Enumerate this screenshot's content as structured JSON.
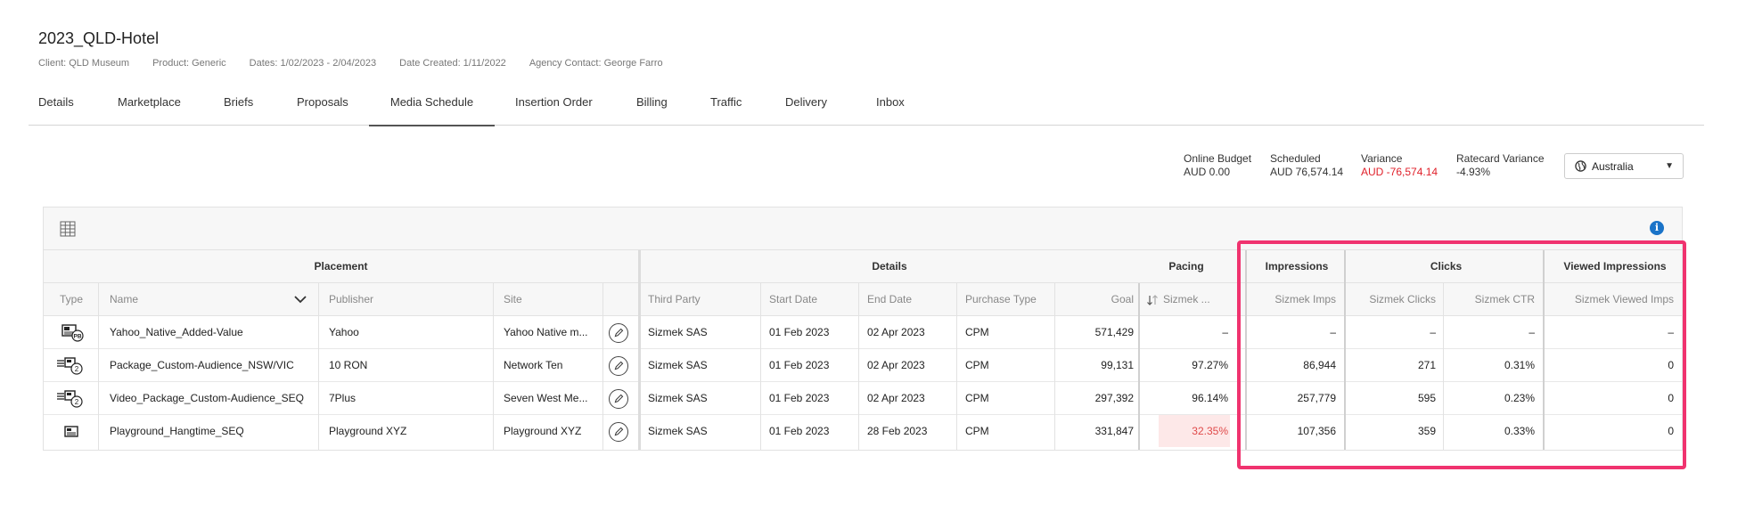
{
  "campaign": {
    "title": "2023_QLD-Hotel",
    "meta": [
      "Client: QLD Museum",
      "Product: Generic",
      "Dates: 1/02/2023 - 2/04/2023",
      "Date Created: 1/11/2022",
      "Agency Contact: George Farro"
    ]
  },
  "tabs": [
    {
      "label": "Details"
    },
    {
      "label": "Marketplace"
    },
    {
      "label": "Briefs"
    },
    {
      "label": "Proposals"
    },
    {
      "label": "Media Schedule",
      "active": true
    },
    {
      "label": "Insertion Order"
    },
    {
      "label": "Billing"
    },
    {
      "label": "Traffic"
    },
    {
      "label": "Delivery"
    },
    {
      "label": "Inbox"
    }
  ],
  "summary": {
    "online_budget": {
      "label": "Online Budget",
      "value": "AUD 0.00"
    },
    "scheduled": {
      "label": "Scheduled",
      "value": "AUD 76,574.14"
    },
    "variance": {
      "label": "Variance",
      "value": "AUD -76,574.14"
    },
    "ratecard_variance": {
      "label": "Ratecard Variance",
      "value": "-4.93%"
    }
  },
  "region": {
    "selected": "Australia",
    "icon": "globe-icon"
  },
  "table": {
    "groups": [
      "Placement",
      "Details",
      "Pacing",
      "Impressions",
      "Clicks",
      "Viewed Impressions"
    ],
    "columns": [
      "Type",
      "Name",
      "Publisher",
      "Site",
      "Third Party",
      "Start Date",
      "End Date",
      "Purchase Type",
      "Goal",
      "Sizmek ...",
      "Sizmek Imps",
      "Sizmek Clicks",
      "Sizmek CTR",
      "Sizmek Viewed Imps"
    ],
    "sort_icon": "sort-arrows-icon",
    "rows": [
      {
        "type_icon": "native-ad-icon",
        "type_badge": "PB",
        "name": "Yahoo_Native_Added-Value",
        "publisher": "Yahoo",
        "site": "Yahoo Native m...",
        "third_party": "Sizmek SAS",
        "start": "01 Feb 2023",
        "end": "02 Apr 2023",
        "purchase": "CPM",
        "goal": "571,429",
        "pacing": "–",
        "imps": "–",
        "clicks": "–",
        "ctr": "–",
        "viewed": "–"
      },
      {
        "type_icon": "package-icon",
        "type_badge": "2",
        "name": "Package_Custom-Audience_NSW/VIC",
        "publisher": "10 RON",
        "site": "Network Ten",
        "third_party": "Sizmek SAS",
        "start": "01 Feb 2023",
        "end": "02 Apr 2023",
        "purchase": "CPM",
        "goal": "99,131",
        "pacing": "97.27%",
        "imps": "86,944",
        "clicks": "271",
        "ctr": "0.31%",
        "viewed": "0"
      },
      {
        "type_icon": "package-icon",
        "type_badge": "2",
        "name": "Video_Package_Custom-Audience_SEQ",
        "publisher": "7Plus",
        "site": "Seven West Me...",
        "third_party": "Sizmek SAS",
        "start": "01 Feb 2023",
        "end": "02 Apr 2023",
        "purchase": "CPM",
        "goal": "297,392",
        "pacing": "96.14%",
        "imps": "257,779",
        "clicks": "595",
        "ctr": "0.23%",
        "viewed": "0"
      },
      {
        "type_icon": "display-ad-icon",
        "type_badge": "",
        "name": "Playground_Hangtime_SEQ",
        "publisher": "Playground XYZ",
        "site": "Playground XYZ",
        "third_party": "Sizmek SAS",
        "start": "01 Feb 2023",
        "end": "28 Feb 2023",
        "purchase": "CPM",
        "goal": "331,847",
        "pacing": "32.35%",
        "pacing_alert": true,
        "imps": "107,356",
        "clicks": "359",
        "ctr": "0.33%",
        "viewed": "0"
      }
    ]
  },
  "colors": {
    "negative": "#e0202a",
    "highlight_border": "#f0336f",
    "pacing_alert_bg": "#fde8e8",
    "info_blue": "#1a73c8"
  }
}
